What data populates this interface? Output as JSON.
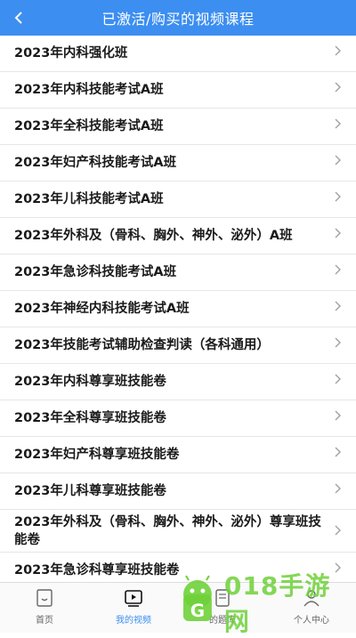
{
  "header": {
    "title": "已激活/购买的视频课程",
    "back_icon": "chevron-left-icon",
    "background": "#3c8ef0"
  },
  "courses": [
    {
      "label": "2023年内科强化班"
    },
    {
      "label": "2023年内科技能考试A班"
    },
    {
      "label": "2023年全科技能考试A班"
    },
    {
      "label": "2023年妇产科技能考试A班"
    },
    {
      "label": "2023年儿科技能考试A班"
    },
    {
      "label": "2023年外科及（骨科、胸外、神外、泌外）A班"
    },
    {
      "label": "2023年急诊科技能考试A班"
    },
    {
      "label": "2023年神经内科技能考试A班"
    },
    {
      "label": "2023年技能考试辅助检查判读（各科通用）"
    },
    {
      "label": "2023年内科尊享班技能卷"
    },
    {
      "label": "2023年全科尊享班技能卷"
    },
    {
      "label": "2023年妇产科尊享班技能卷"
    },
    {
      "label": "2023年儿科尊享班技能卷"
    },
    {
      "label": "2023年外科及（骨科、胸外、神外、泌外）尊享班技能卷"
    },
    {
      "label": "2023年急诊科尊享班技能卷"
    }
  ],
  "tabbar": {
    "tabs": [
      {
        "label": "首页",
        "icon": "home-icon"
      },
      {
        "label": "我的视频",
        "icon": "video-icon",
        "active": true
      },
      {
        "label": "的题库",
        "icon": "question-bank-icon"
      },
      {
        "label": "个人中心",
        "icon": "user-icon"
      }
    ],
    "active_color": "#3c8ef0"
  },
  "watermark": {
    "text": "018手游网",
    "icon": "android-robot-logo"
  }
}
